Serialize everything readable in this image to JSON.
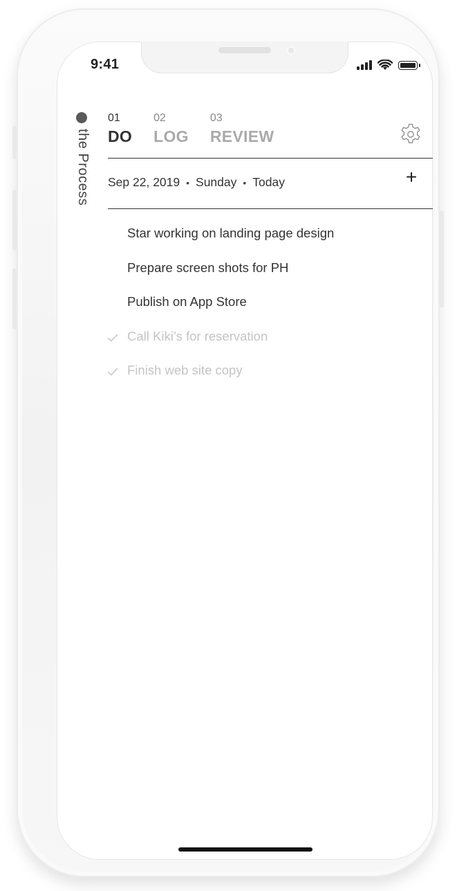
{
  "status_bar": {
    "time": "9:41"
  },
  "app": {
    "brand": "the Process"
  },
  "tabs": [
    {
      "number": "01",
      "label": "DO",
      "active": true
    },
    {
      "number": "02",
      "label": "LOG",
      "active": false
    },
    {
      "number": "03",
      "label": "REVIEW",
      "active": false
    }
  ],
  "date_bar": {
    "date": "Sep 22, 2019",
    "weekday": "Sunday",
    "relative": "Today",
    "separator": "•",
    "add_label": "+"
  },
  "tasks": [
    {
      "text": "Star working on landing page design",
      "done": false
    },
    {
      "text": "Prepare screen shots for PH",
      "done": false
    },
    {
      "text": "Publish on App Store",
      "done": false
    },
    {
      "text": "Call Kiki’s for reservation",
      "done": true
    },
    {
      "text": "Finish web site copy",
      "done": true
    }
  ],
  "icons": {
    "settings": "gear-icon",
    "add": "plus-icon",
    "done": "checkmark-icon",
    "signal": "cellular-signal-icon",
    "wifi": "wifi-icon",
    "battery": "battery-icon"
  },
  "colors": {
    "text_primary": "#333333",
    "text_inactive": "#aaaaaa",
    "text_done": "#c4c4c4",
    "brand_dot": "#5a5a5a"
  }
}
